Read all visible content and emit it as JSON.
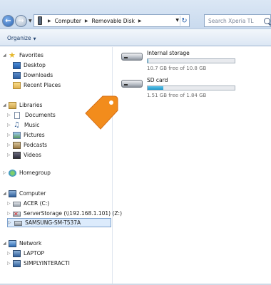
{
  "address": {
    "crumbs": [
      "Computer",
      "Removable Disk"
    ]
  },
  "search": {
    "placeholder": "Search Xperia TL"
  },
  "toolbar": {
    "organize_label": "Organize"
  },
  "nav": {
    "favorites": {
      "label": "Favorites",
      "items": [
        "Desktop",
        "Downloads",
        "Recent Places"
      ]
    },
    "libraries": {
      "label": "Libraries",
      "items": [
        "Documents",
        "Music",
        "Pictures",
        "Podcasts",
        "Videos"
      ]
    },
    "homegroup": {
      "label": "Homegroup"
    },
    "computer": {
      "label": "Computer",
      "items": [
        "ACER (C:)",
        "ServerStorage (\\\\192.168.1.101) (Z:)",
        "SAMSUNG-SM-T537A"
      ]
    },
    "network": {
      "label": "Network",
      "items": [
        "LAPTOP",
        "SIMPLYINTERACTI"
      ]
    }
  },
  "storage": [
    {
      "name": "Internal storage",
      "free_text": "10.7 GB free of 10.8 GB",
      "used_fraction": 0.01
    },
    {
      "name": "SD card",
      "free_text": "1.51 GB free of 1.84 GB",
      "used_fraction": 0.18
    }
  ],
  "colors": {
    "tag": "#f28c1c",
    "accent": "#2a62ad"
  }
}
